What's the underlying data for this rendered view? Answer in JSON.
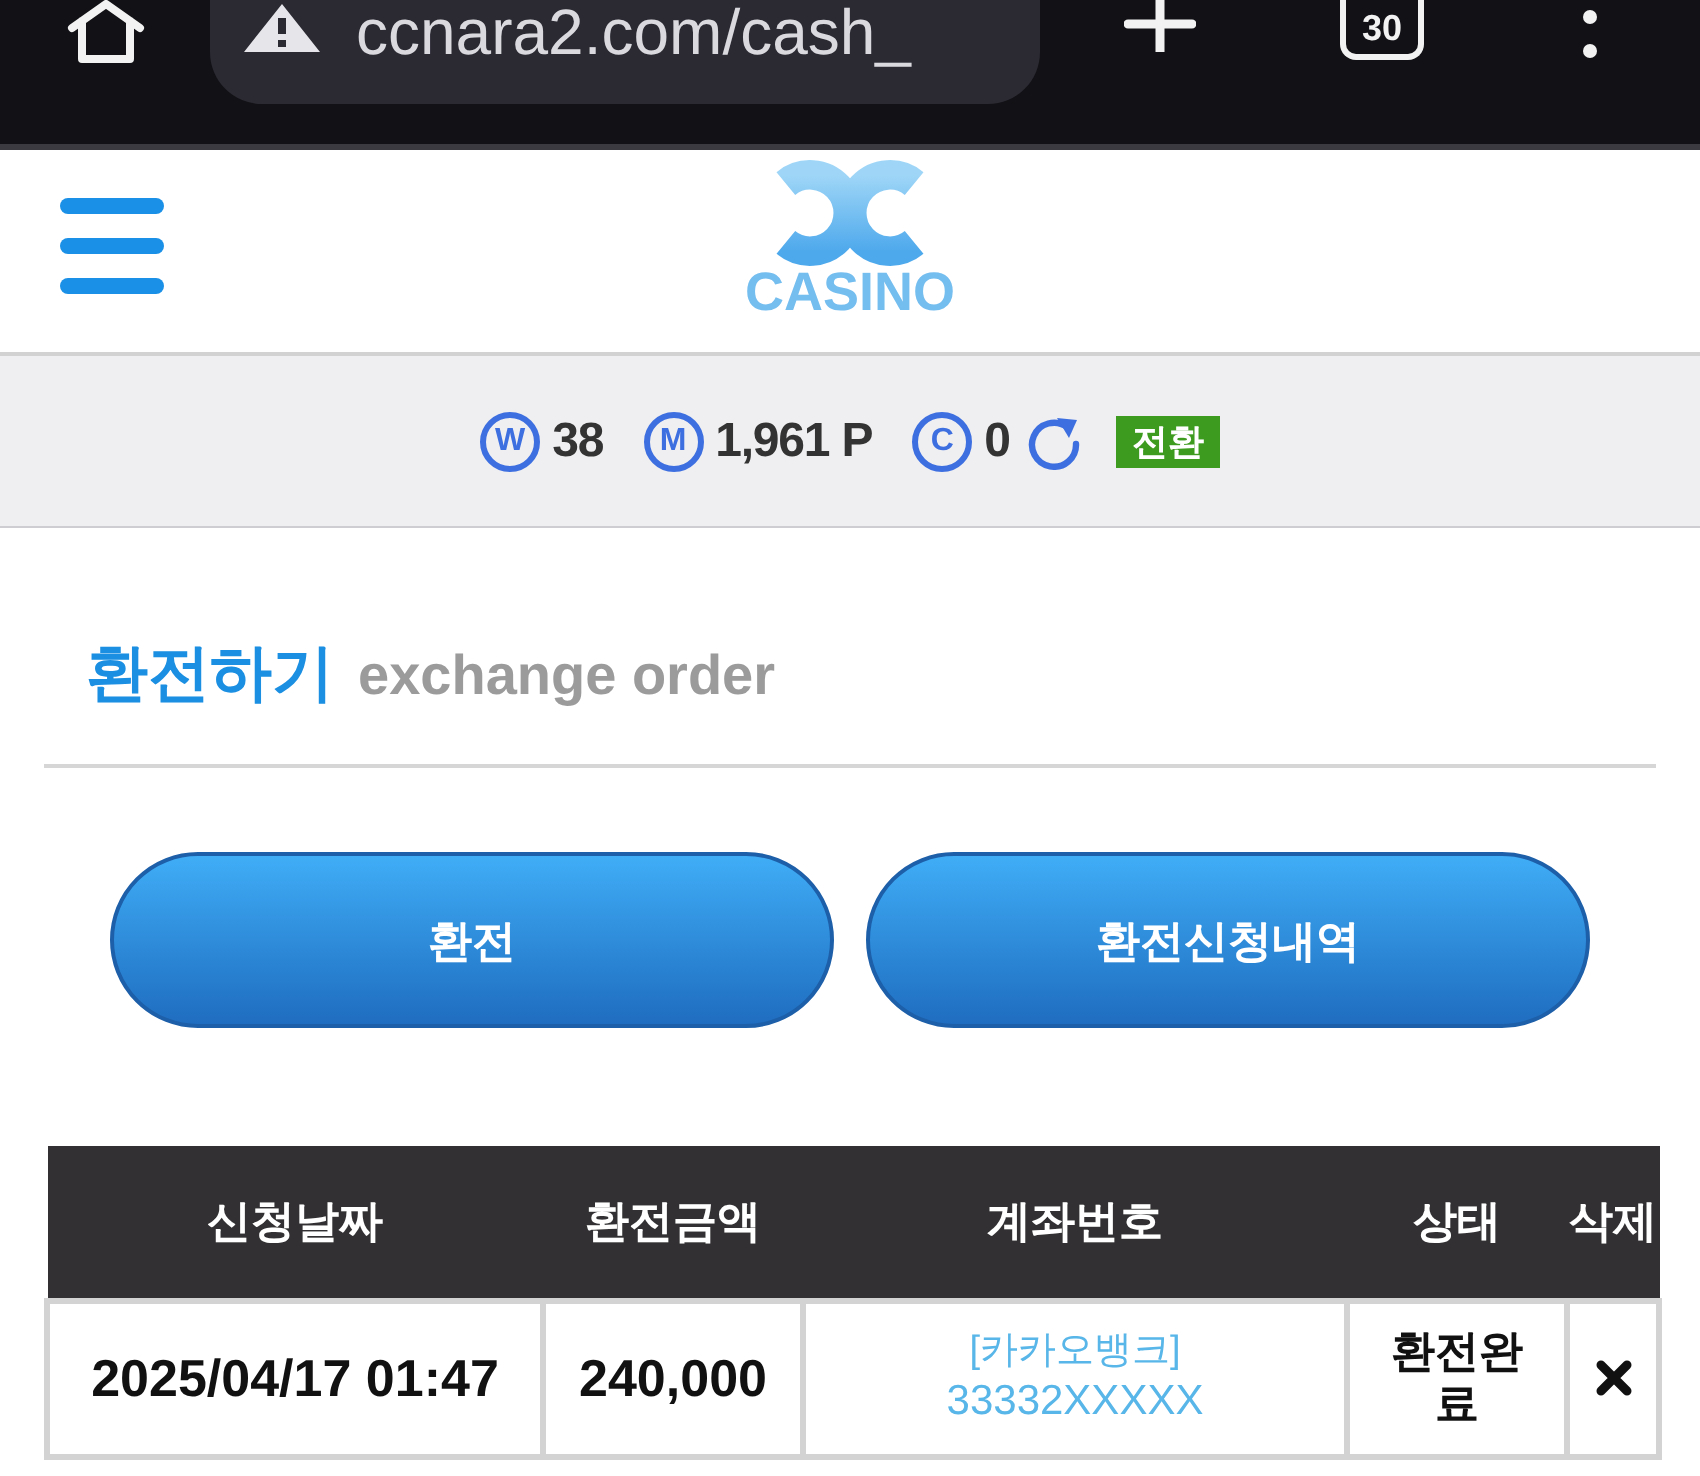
{
  "browser_toolbar": {
    "url": "ccnara2.com/cash_",
    "tab_count": "30"
  },
  "header": {
    "logo_text": "CASINO"
  },
  "balance_bar": {
    "balances": [
      {
        "letter": "W",
        "value": "38"
      },
      {
        "letter": "M",
        "value": "1,961 P"
      },
      {
        "letter": "C",
        "value": "0"
      }
    ],
    "convert_button": "전환"
  },
  "section": {
    "title": "환전하기",
    "subtitle": "exchange order"
  },
  "buttons": [
    {
      "label": "환전"
    },
    {
      "label": "환전신청내역"
    }
  ],
  "table": {
    "columns": [
      "신청날짜",
      "환전금액",
      "계좌번호",
      "상태",
      "삭제"
    ],
    "rows": [
      {
        "date": "2025/04/17 01:47",
        "amount": "240,000",
        "bank": "[카카오뱅크]",
        "account": "33332XXXXX",
        "status": "환전완료"
      }
    ]
  }
}
